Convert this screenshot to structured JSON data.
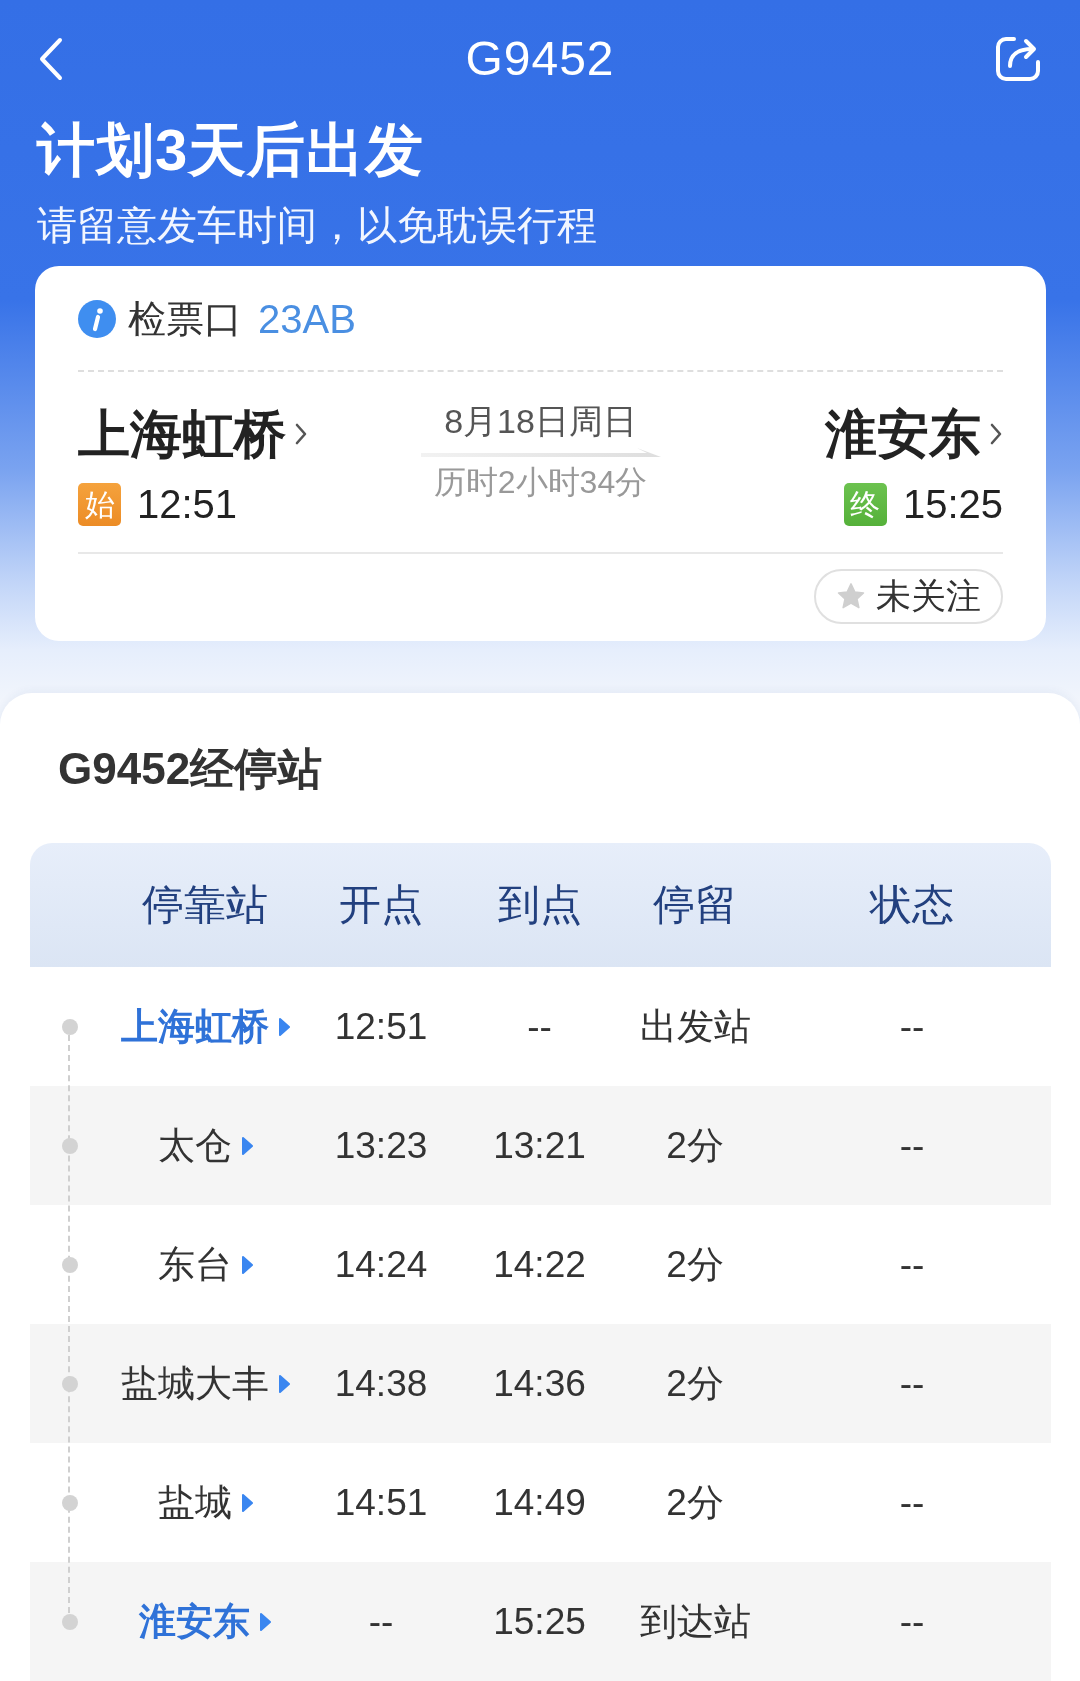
{
  "nav_bar": {
    "title": "G9452"
  },
  "banner": {
    "headline": "计划3天后出发",
    "subtitle": "请留意发车时间，以免耽误行程"
  },
  "trip_card": {
    "gate": {
      "label": "检票口",
      "value": "23AB"
    },
    "departure": {
      "station": "上海虹桥",
      "badge": "始",
      "time": "12:51"
    },
    "date": "8月18日周日",
    "duration": "历时2小时34分",
    "arrival": {
      "station": "淮安东",
      "badge": "终",
      "time": "15:25"
    },
    "follow_button": {
      "label": "未关注",
      "followed": false
    }
  },
  "stops": {
    "title": "G9452经停站",
    "columns": [
      "停靠站",
      "开点",
      "到点",
      "停留",
      "状态"
    ],
    "rows": [
      {
        "kind": "origin",
        "station": "上海虹桥",
        "departs": "12:51",
        "arrives": "--",
        "stay": "出发站",
        "status": "--"
      },
      {
        "kind": "stop",
        "station": "太仓",
        "departs": "13:23",
        "arrives": "13:21",
        "stay": "2分",
        "status": "--"
      },
      {
        "kind": "stop",
        "station": "东台",
        "departs": "14:24",
        "arrives": "14:22",
        "stay": "2分",
        "status": "--"
      },
      {
        "kind": "stop",
        "station": "盐城大丰",
        "departs": "14:38",
        "arrives": "14:36",
        "stay": "2分",
        "status": "--"
      },
      {
        "kind": "stop",
        "station": "盐城",
        "departs": "14:51",
        "arrives": "14:49",
        "stay": "2分",
        "status": "--"
      },
      {
        "kind": "terminus",
        "station": "淮安东",
        "departs": "--",
        "arrives": "15:25",
        "stay": "到达站",
        "status": "--"
      }
    ]
  }
}
